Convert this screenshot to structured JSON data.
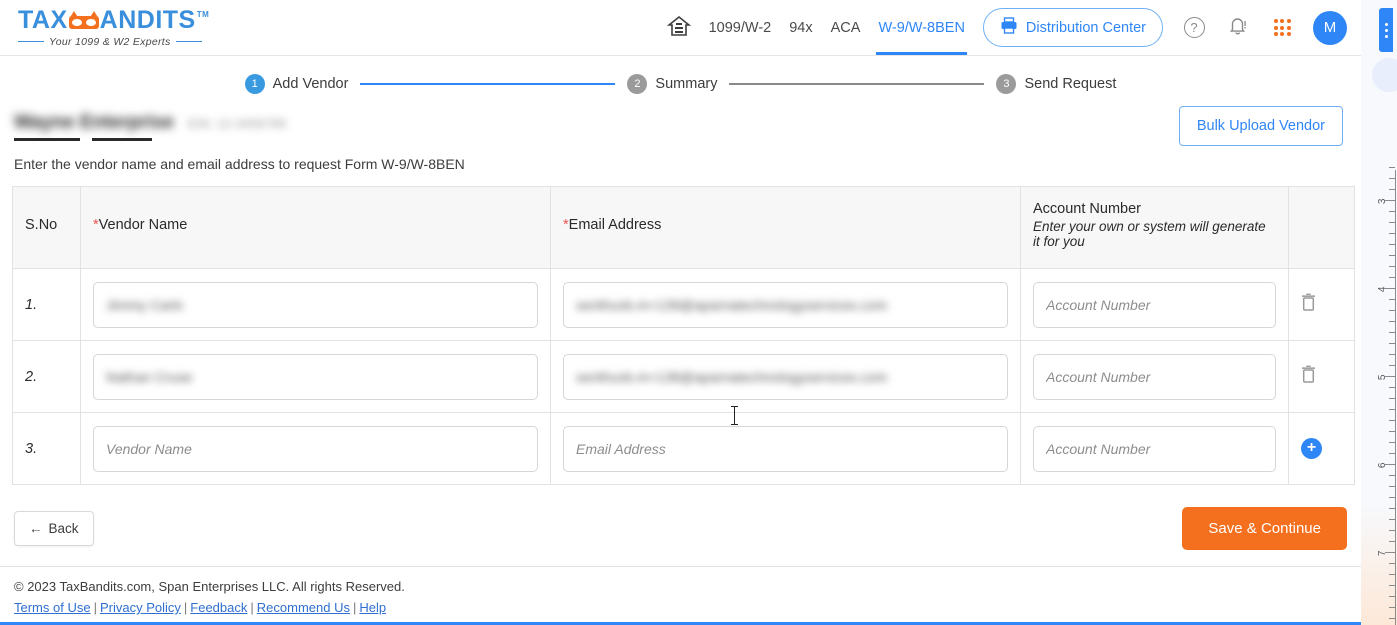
{
  "brand": {
    "name_part1": "TAX",
    "name_part2": "ANDITS",
    "tm": "TM",
    "tagline": "Your 1099 & W2 Experts"
  },
  "header": {
    "home_icon": "home-icon",
    "nav": [
      {
        "label": "1099/W-2",
        "active": false
      },
      {
        "label": "94x",
        "active": false
      },
      {
        "label": "ACA",
        "active": false
      },
      {
        "label": "W-9/W-8BEN",
        "active": true
      }
    ],
    "distribution_button": "Distribution Center",
    "printer_icon": "printer-icon",
    "help_icon": "?",
    "bell_icon": "bell-icon",
    "apps_icon": "apps-grid-icon",
    "avatar_initial": "M"
  },
  "stepper": {
    "steps": [
      {
        "num": "1",
        "label": "Add Vendor",
        "state": "active"
      },
      {
        "num": "2",
        "label": "Summary",
        "state": "inactive"
      },
      {
        "num": "3",
        "label": "Send Request",
        "state": "inactive"
      }
    ]
  },
  "business": {
    "name": "Wayne Enterprise",
    "ein": "EIN: 12-3456789",
    "redacted": true
  },
  "bulk_upload_button": "Bulk Upload Vendor",
  "instruction": "Enter the vendor name and email address to request Form W-9/W-8BEN",
  "table": {
    "columns": {
      "sno": "S.No",
      "vendor_name": "Vendor Name",
      "email_address": "Email Address",
      "account_number": "Account Number",
      "account_number_sub": "Enter your own or system will generate it for you",
      "required_marker": "*"
    },
    "placeholders": {
      "vendor_name": "Vendor Name",
      "email_address": "Email Address",
      "account_number": "Account Number"
    },
    "rows": [
      {
        "sno": "1.",
        "vendor_name": "Jimmy Carls",
        "email_address": "senthuvb.m+139@aparnatechnologyservices.com",
        "account_number": "",
        "redacted": true,
        "action": "delete"
      },
      {
        "sno": "2.",
        "vendor_name": "Nathan Cruse",
        "email_address": "senthuvb.m+138@aparnatechnologyservices.com",
        "account_number": "",
        "redacted": true,
        "action": "delete"
      },
      {
        "sno": "3.",
        "vendor_name": "",
        "email_address": "",
        "account_number": "",
        "redacted": false,
        "action": "add"
      }
    ]
  },
  "actions": {
    "back_label": "Back",
    "back_arrow": "←",
    "save_label": "Save & Continue"
  },
  "footer": {
    "copyright": "© 2023 TaxBandits.com, Span Enterprises LLC. All rights Reserved.",
    "links": [
      "Terms of Use",
      "Privacy Policy",
      "Feedback",
      "Recommend Us",
      "Help"
    ],
    "separator": "|"
  },
  "ruler": {
    "labels": [
      "3",
      "4",
      "5",
      "6",
      "7"
    ]
  },
  "colors": {
    "brand_blue": "#2f86f6",
    "brand_orange": "#f4701f",
    "active_step": "#3a9ae0",
    "inactive_step": "#9b9b9b",
    "required_red": "#e8534f"
  }
}
